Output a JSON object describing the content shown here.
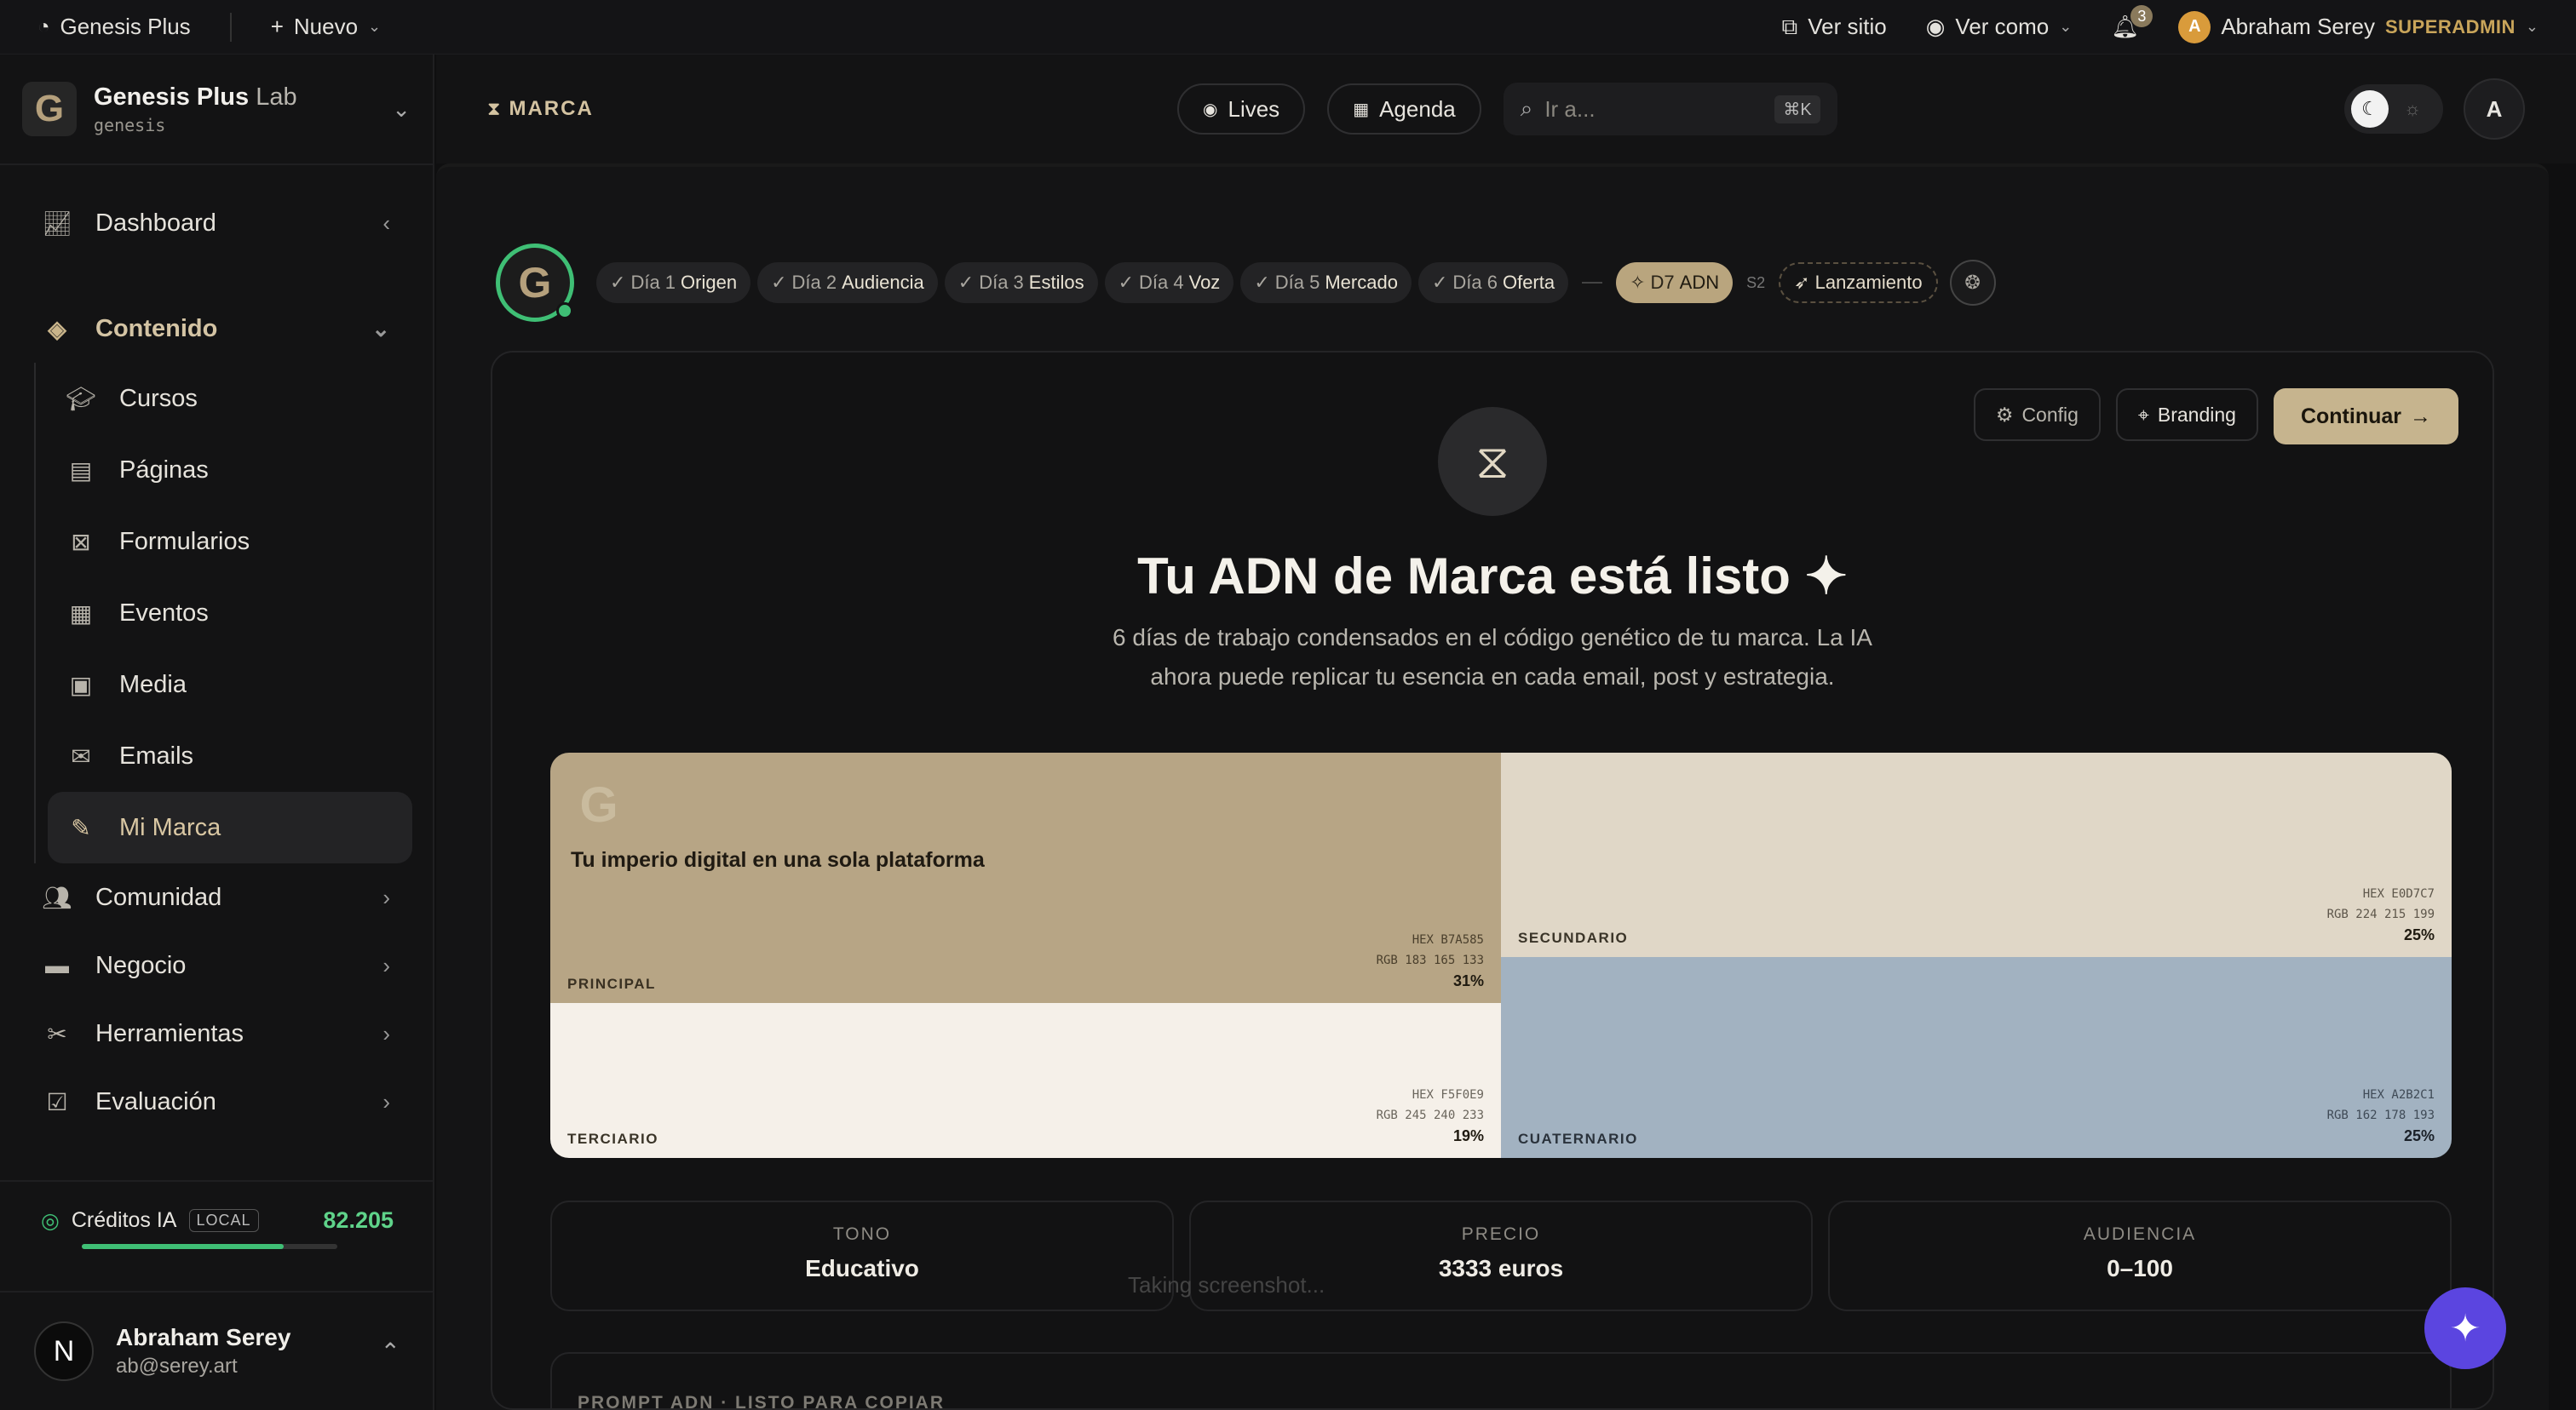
{
  "topbar": {
    "site_name": "Genesis Plus",
    "new_label": "Nuevo",
    "view_site": "Ver sitio",
    "view_as": "Ver como",
    "notifications_count": "3",
    "user_initial": "A",
    "user_name": "Abraham Serey",
    "role": "SUPERADMIN"
  },
  "sidebar": {
    "brand_title": "Genesis Plus",
    "brand_title_suffix": "Lab",
    "brand_sub": "genesis",
    "items": {
      "dashboard": "Dashboard",
      "contenido": "Contenido",
      "cursos": "Cursos",
      "paginas": "Páginas",
      "formularios": "Formularios",
      "eventos": "Eventos",
      "media": "Media",
      "emails": "Emails",
      "mi_marca": "Mi Marca",
      "comunidad": "Comunidad",
      "negocio": "Negocio",
      "herramientas": "Herramientas",
      "evaluacion": "Evaluación"
    },
    "credits": {
      "label": "Créditos IA",
      "badge": "LOCAL",
      "value": "82.205",
      "fill": 0.79
    },
    "user": {
      "initial": "N",
      "name": "Abraham Serey",
      "email": "ab@serey.art"
    }
  },
  "header": {
    "section": "MARCA",
    "lives": "Lives",
    "agenda": "Agenda",
    "search_placeholder": "Ir a...",
    "shortcut": "⌘K",
    "avatar": "A"
  },
  "steps": [
    {
      "day": "Día 1",
      "name": "Origen"
    },
    {
      "day": "Día 2",
      "name": "Audiencia"
    },
    {
      "day": "Día 3",
      "name": "Estilos"
    },
    {
      "day": "Día 4",
      "name": "Voz"
    },
    {
      "day": "Día 5",
      "name": "Mercado"
    },
    {
      "day": "Día 6",
      "name": "Oferta"
    }
  ],
  "current_step": {
    "day": "D7",
    "name": "ADN"
  },
  "s2_label": "S2",
  "launch_label": "Lanzamiento",
  "card": {
    "config": "Config",
    "branding": "Branding",
    "continue": "Continuar",
    "title": "Tu ADN de Marca está listo ✦",
    "desc": "6 días de trabajo condensados en el código genético de tu marca. La IA ahora puede replicar tu esencia en cada email, post y estrategia."
  },
  "palette": {
    "tagline": "Tu imperio digital en una sola plataforma",
    "principal": {
      "label": "PRINCIPAL",
      "hex": "HEX B7A585",
      "rgb": "RGB 183 165 133",
      "pct": "31%",
      "color": "#b7a585"
    },
    "secundario": {
      "label": "SECUNDARIO",
      "hex": "HEX E0D7C7",
      "rgb": "RGB 224 215 199",
      "pct": "25%",
      "color": "#e0d7c7"
    },
    "terciario": {
      "label": "TERCIARIO",
      "hex": "HEX F5F0E9",
      "rgb": "RGB 245 240 233",
      "pct": "19%",
      "color": "#f5f0e9"
    },
    "cuaternario": {
      "label": "CUATERNARIO",
      "hex": "HEX A2B2C1",
      "rgb": "RGB 162 178 193",
      "pct": "25%",
      "color": "#a2b2c1"
    }
  },
  "stats": [
    {
      "label": "TONO",
      "value": "Educativo"
    },
    {
      "label": "PRECIO",
      "value": "3333 euros"
    },
    {
      "label": "AUDIENCIA",
      "value": "0–100"
    }
  ],
  "prompt_label": "PROMPT ADN · LISTO PARA COPIAR",
  "toast": "Taking screenshot..."
}
